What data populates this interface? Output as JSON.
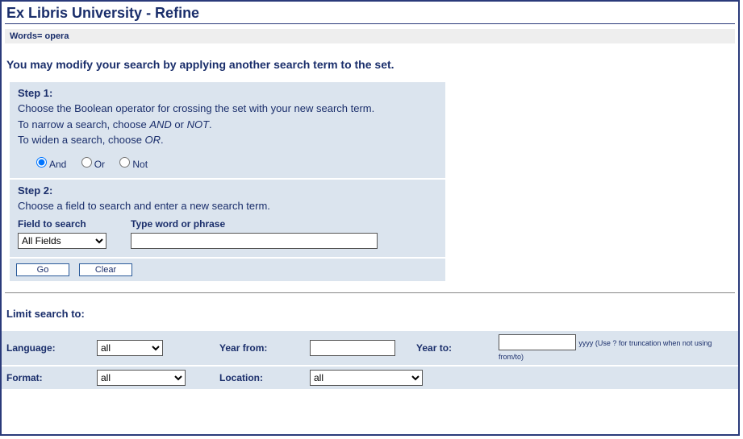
{
  "title": "Ex Libris University - Refine",
  "words_bar": "Words= opera",
  "intro": "You may modify your search by applying another search term to the set.",
  "step1": {
    "label": "Step 1:",
    "line1": "Choose the Boolean operator for crossing the set with your new search term.",
    "line2a": "To narrow a search, choose ",
    "line2b_em": "AND",
    "line2c": " or ",
    "line2d_em": "NOT",
    "line2e": ".",
    "line3a": "To widen a search, choose ",
    "line3b_em": "OR",
    "line3c": ".",
    "radios": {
      "and": "And",
      "or": "Or",
      "not": "Not"
    }
  },
  "step2": {
    "label": "Step 2:",
    "line1": "Choose a field to search and enter a new search term.",
    "field_label": "Field to search",
    "phrase_label": "Type word or phrase",
    "field_selected": "All Fields",
    "phrase_value": ""
  },
  "buttons": {
    "go": "Go",
    "clear": "Clear"
  },
  "limits": {
    "title": "Limit search to:",
    "language_label": "Language:",
    "language_value": "all",
    "yearfrom_label": "Year from:",
    "yearfrom_value": "",
    "yearto_label": "Year to:",
    "yearto_value": "",
    "year_hint": "yyyy (Use ? for truncation when not using from/to)",
    "format_label": "Format:",
    "format_value": "all",
    "location_label": "Location:",
    "location_value": "all"
  }
}
